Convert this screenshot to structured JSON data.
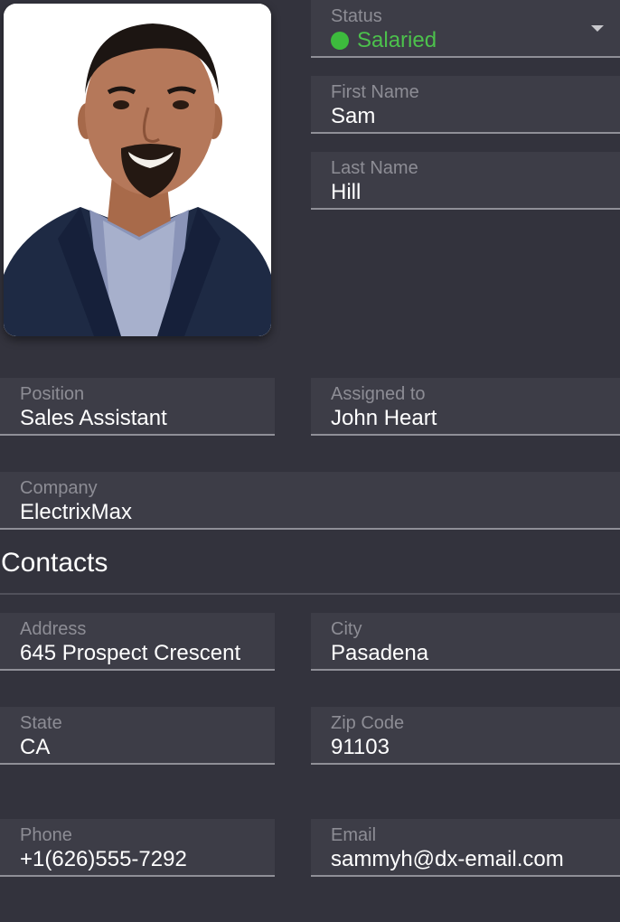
{
  "profile": {
    "photo_alt": ""
  },
  "status": {
    "label": "Status",
    "value": "Salaried",
    "color": "#4cc14c"
  },
  "first_name": {
    "label": "First Name",
    "value": "Sam"
  },
  "last_name": {
    "label": "Last Name",
    "value": "Hill"
  },
  "position": {
    "label": "Position",
    "value": "Sales Assistant"
  },
  "assigned_to": {
    "label": "Assigned to",
    "value": "John Heart"
  },
  "company": {
    "label": "Company",
    "value": "ElectrixMax"
  },
  "contacts": {
    "title": "Contacts",
    "address": {
      "label": "Address",
      "value": "645 Prospect Crescent"
    },
    "city": {
      "label": "City",
      "value": "Pasadena"
    },
    "state": {
      "label": "State",
      "value": "CA"
    },
    "zip": {
      "label": "Zip Code",
      "value": "91103"
    },
    "phone": {
      "label": "Phone",
      "value": "+1(626)555-7292"
    },
    "email": {
      "label": "Email",
      "value": "sammyh@dx-email.com"
    }
  },
  "theme": {
    "background": "#33333d",
    "field_background": "#3d3d47",
    "underline": "#8f8f97",
    "label_color": "#8d8d95"
  }
}
